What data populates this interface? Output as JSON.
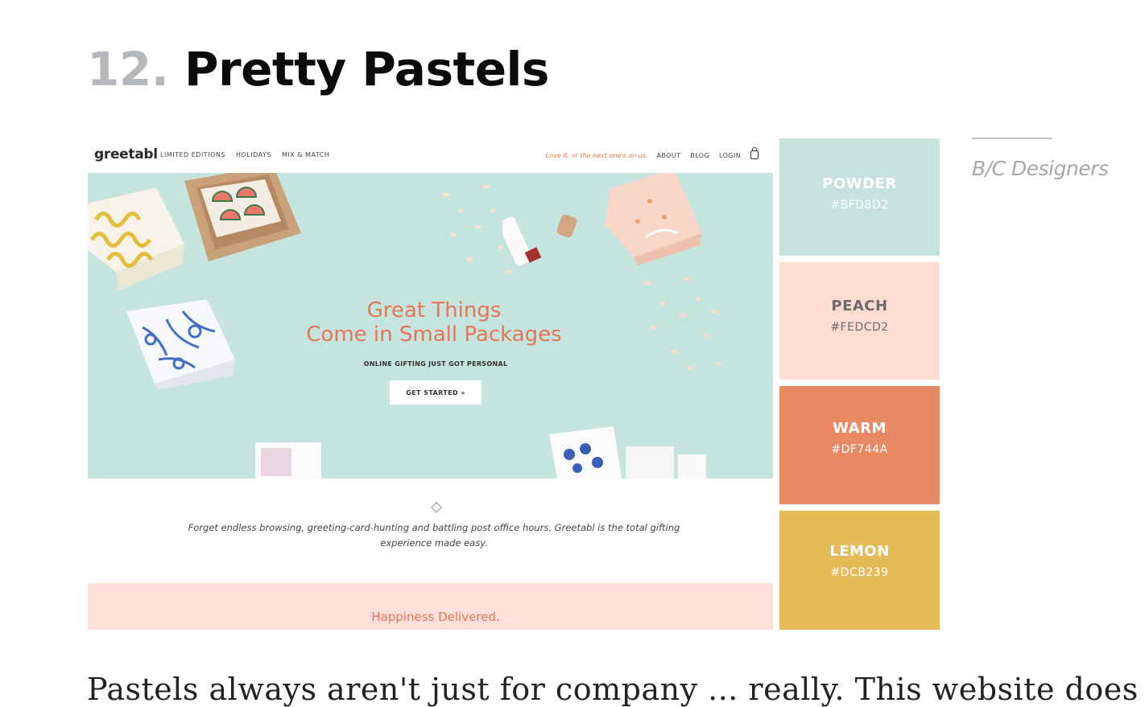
{
  "heading": {
    "number": "12.",
    "title": "Pretty Pastels"
  },
  "screenshot": {
    "logo": "greetabl",
    "nav_links": [
      "LIMITED EDITIONS",
      "HOLIDAYS",
      "MIX & MATCH"
    ],
    "tagline": "Love it, or the next one's on us.",
    "right_links": [
      "ABOUT",
      "BLOG",
      "LOGIN"
    ],
    "headline_line1": "Great Things",
    "headline_line2": "Come in Small Packages",
    "subheadline": "ONLINE GIFTING JUST GOT PERSONAL",
    "cta": "GET STARTED »",
    "description": "Forget endless browsing, greeting-card-hunting and battling post office hours. Greetabl is the total gifting experience made easy.",
    "footer_heading": "Happiness Delivered."
  },
  "palette": [
    {
      "name": "POWDER",
      "hex": "#BFD8D2",
      "color": "#c7e1dc",
      "text_color": "#ffffff"
    },
    {
      "name": "PEACH",
      "hex": "#FEDCD2",
      "color": "#fedcd2",
      "text_color": "#6b6b6b"
    },
    {
      "name": "WARM",
      "hex": "#DF744A",
      "color": "#e88964",
      "text_color": "#ffffff"
    },
    {
      "name": "LEMON",
      "hex": "#DCB239",
      "color": "#e4bb57",
      "text_color": "#ffffff"
    }
  ],
  "credit": "B/C Designers",
  "body_text": "Pastels always aren't just for company ... really. This website does"
}
